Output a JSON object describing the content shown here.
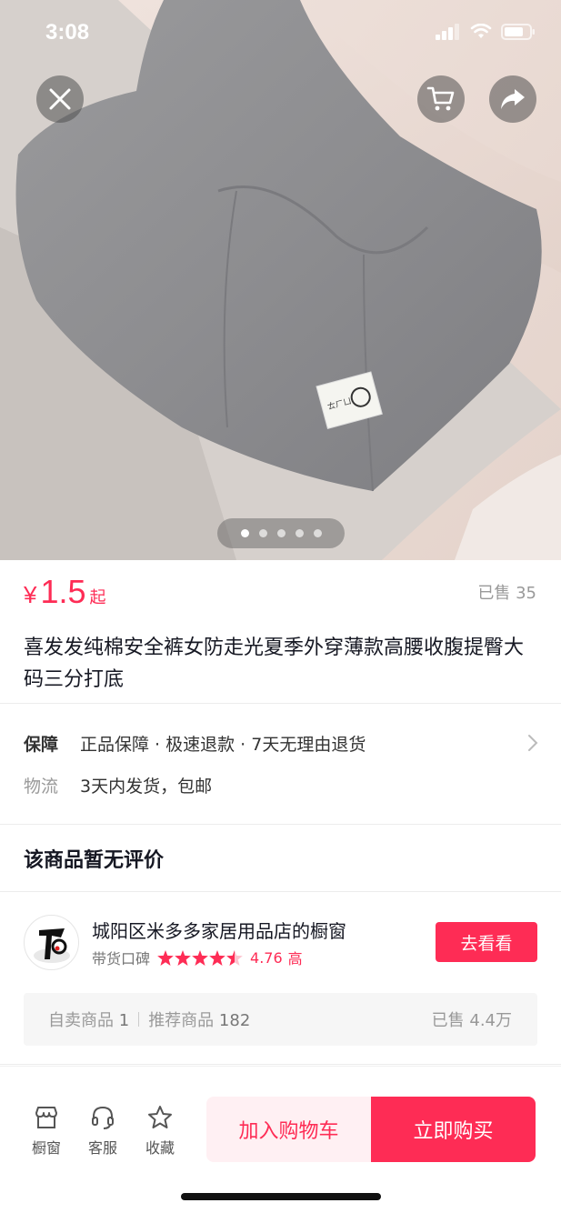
{
  "status_bar": {
    "time": "3:08"
  },
  "hero": {
    "page_count": 5,
    "active_index": 0,
    "product_tag_text": "ㄊㄏㄩ"
  },
  "price": {
    "currency": "¥",
    "amount": "1.5",
    "suffix": "起",
    "sold": "已售 35"
  },
  "title": "喜发发纯棉安全裤女防走光夏季外穿薄款高腰收腹提臀大码三分打底",
  "guarantee": {
    "label": "保障",
    "text": "正品保障 · 极速退款 · 7天无理由退货"
  },
  "logistics": {
    "label": "物流",
    "text": "3天内发货，包邮"
  },
  "reviews": {
    "empty_text": "该商品暂无评价"
  },
  "shop": {
    "name": "城阳区米多多家居用品店的橱窗",
    "reputation_label": "带货口碑",
    "rating": "4.76",
    "rating_level": "高",
    "star_count": 4.5,
    "visit_label": "去看看",
    "self_sold_label": "自卖商品",
    "self_sold_count": "1",
    "recommended_label": "推荐商品",
    "recommended_count": "182",
    "total_sold": "已售 4.4万"
  },
  "bottom_bar": {
    "showcase_label": "橱窗",
    "service_label": "客服",
    "favorite_label": "收藏",
    "add_cart_label": "加入购物车",
    "buy_now_label": "立即购买"
  },
  "colors": {
    "accent": "#fe2c55",
    "accent_light": "#fff0f3"
  }
}
